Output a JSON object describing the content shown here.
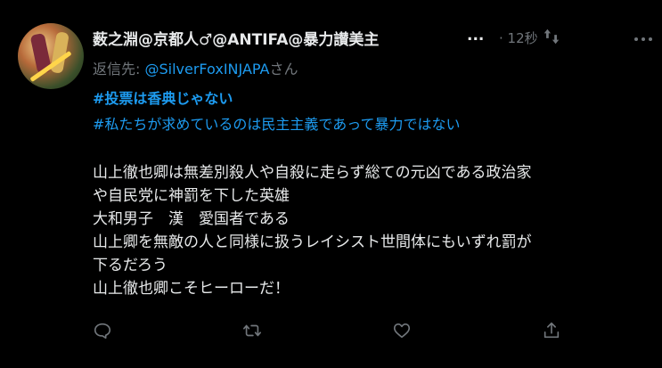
{
  "tweet": {
    "author_name": "薮之淵@京都人♂@ANTIFA@暴力讃美主",
    "ellipsis": "...",
    "time": "· 12秒",
    "reply_prefix": "返信先: ",
    "reply_handle": "@SilverFoxINJAPA",
    "reply_suffix": "さん",
    "hashtags": [
      "#投票は香典じゃない",
      "#私たちが求めているのは民主主義であって暴力ではない"
    ],
    "body_lines": [
      "山上徹也卿は無差別殺人や自殺に走らず総ての元凶である政治家",
      "や自民党に神罰を下した英雄",
      "大和男子　漢　愛国者である",
      "山上卿を無敵の人と同様に扱うレイシスト世間体にもいずれ罰が",
      "下るだろう",
      "山上徹也卿こそヒーローだ！"
    ]
  },
  "colors": {
    "background": "#000000",
    "text": "#e7e9ea",
    "muted": "#71767b",
    "accent": "#1d9bf0"
  },
  "icons": [
    "more-icon",
    "reply-icon",
    "retweet-icon",
    "like-icon",
    "share-icon"
  ]
}
